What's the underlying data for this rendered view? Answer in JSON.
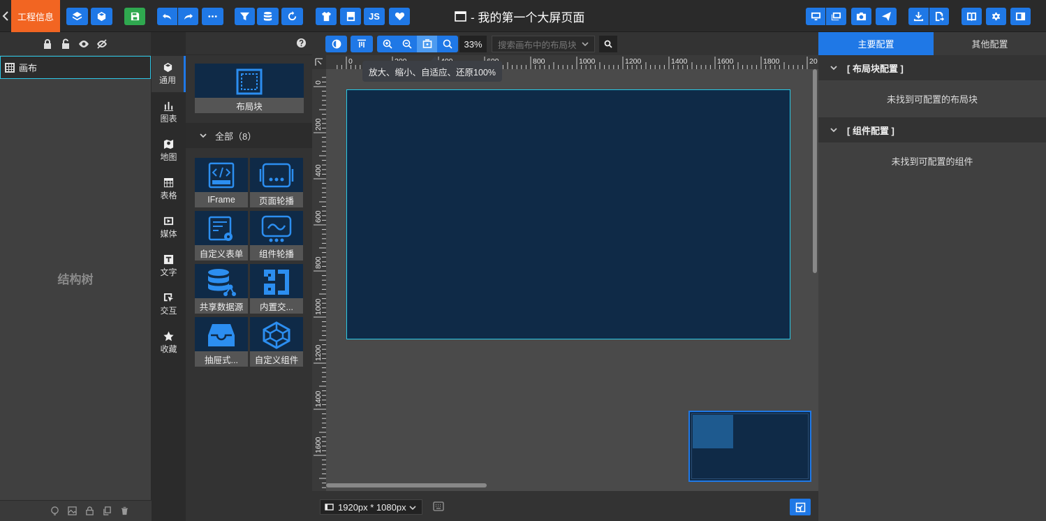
{
  "topbar": {
    "project_label": "工程信息",
    "page_title": "- 我的第一个大屏页面",
    "js_label": "JS"
  },
  "structure": {
    "root_node": "画布",
    "placeholder": "结构树"
  },
  "rail": {
    "items": [
      {
        "label": "通用",
        "icon": "cube-icon"
      },
      {
        "label": "图表",
        "icon": "bar-chart-icon"
      },
      {
        "label": "地图",
        "icon": "map-icon"
      },
      {
        "label": "表格",
        "icon": "table-icon"
      },
      {
        "label": "媒体",
        "icon": "media-icon"
      },
      {
        "label": "文字",
        "icon": "text-icon"
      },
      {
        "label": "交互",
        "icon": "interaction-icon"
      },
      {
        "label": "收藏",
        "icon": "star-icon"
      }
    ]
  },
  "palette": {
    "layout_block": "布局块",
    "group_title": "全部（8）",
    "components": [
      {
        "label": "IFrame",
        "icon": "iframe-icon"
      },
      {
        "label": "页面轮播",
        "icon": "page-carousel-icon"
      },
      {
        "label": "自定义表单",
        "icon": "custom-form-icon"
      },
      {
        "label": "组件轮播",
        "icon": "component-carousel-icon"
      },
      {
        "label": "共享数据源",
        "icon": "shared-datasource-icon"
      },
      {
        "label": "内置交...",
        "icon": "builtin-interaction-icon"
      },
      {
        "label": "抽屉式...",
        "icon": "drawer-icon"
      },
      {
        "label": "自定义组件",
        "icon": "custom-component-icon"
      }
    ]
  },
  "stage": {
    "zoom": "33%",
    "search_placeholder": "搜索画布中的布局块",
    "tooltip": "放大、缩小、自适应、还原100%",
    "canvas_size": "1920px * 1080px",
    "ruler_top": [
      "0",
      "200",
      "400",
      "600",
      "800",
      "1000",
      "1200",
      "1400",
      "1600",
      "1800",
      "20"
    ],
    "ruler_left": [
      "0",
      "200",
      "400",
      "600",
      "800",
      "1000",
      "1200",
      "1400",
      "1600"
    ]
  },
  "config": {
    "tabs": [
      "主要配置",
      "其他配置"
    ],
    "layout_section": "[ 布局块配置 ]",
    "layout_empty": "未找到可配置的布局块",
    "component_section": "[ 组件配置 ]",
    "component_empty": "未找到可配置的组件"
  },
  "colors": {
    "accent": "#1f78e6",
    "project": "#f26522",
    "save": "#2fa84f",
    "canvas_bg": "#0f2a47",
    "canvas_border": "#29c9e6"
  }
}
